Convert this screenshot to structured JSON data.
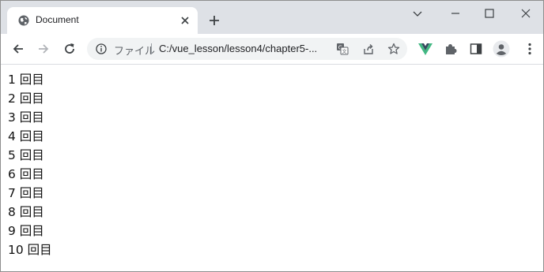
{
  "tab": {
    "title": "Document"
  },
  "address_bar": {
    "security_label": "ファイル",
    "url": "C:/vue_lesson/lesson4/chapter5-..."
  },
  "icons": {
    "tab_favicon": "globe-icon",
    "extension_1": "vue-devtools-icon",
    "extension_2": "puzzle-icon"
  },
  "colors": {
    "vue_green": "#42b883",
    "tabstrip": "#dee1e6",
    "omnibox": "#f1f3f4"
  },
  "page": {
    "items": [
      "1 回目",
      "2 回目",
      "3 回目",
      "4 回目",
      "5 回目",
      "6 回目",
      "7 回目",
      "8 回目",
      "9 回目",
      "10 回目"
    ]
  }
}
